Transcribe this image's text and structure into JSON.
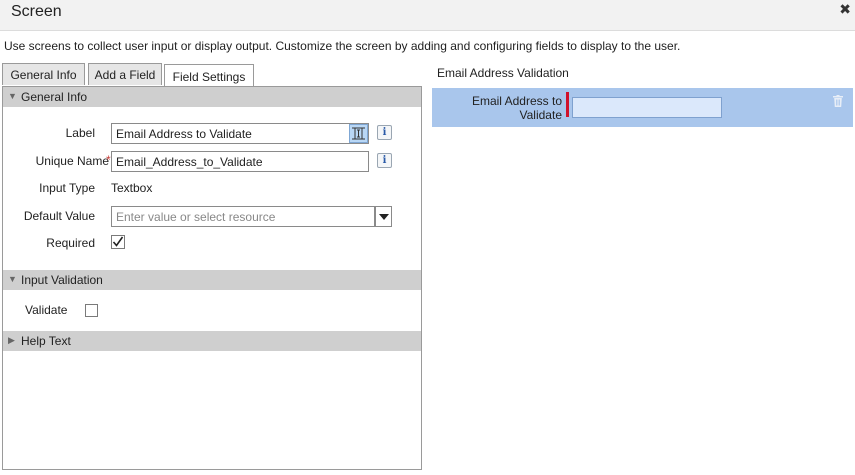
{
  "window": {
    "title": "Screen"
  },
  "instructions": "Use screens to collect user input or display output. Customize the screen by adding and configuring fields to display to the user.",
  "tabs": [
    {
      "label": "General Info",
      "active": false
    },
    {
      "label": "Add a Field",
      "active": false
    },
    {
      "label": "Field Settings",
      "active": true
    }
  ],
  "sections": {
    "general_info": {
      "header": "General Info",
      "label_field": {
        "label": "Label",
        "value": "Email Address to Validate"
      },
      "unique_name": {
        "label": "Unique Name",
        "required_mark": "*",
        "value": "Email_Address_to_Validate"
      },
      "input_type": {
        "label": "Input Type",
        "value": "Textbox"
      },
      "default_value": {
        "label": "Default Value",
        "placeholder": "Enter value or select resource"
      },
      "required": {
        "label": "Required",
        "checked": true
      }
    },
    "input_validation": {
      "header": "Input Validation",
      "validate": {
        "label": "Validate",
        "checked": false
      }
    },
    "help_text": {
      "header": "Help Text"
    }
  },
  "preview": {
    "title": "Email Address Validation",
    "field_label": "Email Address to Validate"
  },
  "icons": {
    "close": "close-icon",
    "info": "info-icon",
    "resource_picker": "resource-picker-icon",
    "dropdown": "chevron-down-icon",
    "checkmark": "checkmark-icon",
    "trash": "trash-icon"
  },
  "info_glyph": "i",
  "colors": {
    "section_header_bg": "#cfcfcf",
    "preview_highlight": "#a9c6ec",
    "required_marker": "#d0112b",
    "tab_bg": "#e6e6e6"
  }
}
